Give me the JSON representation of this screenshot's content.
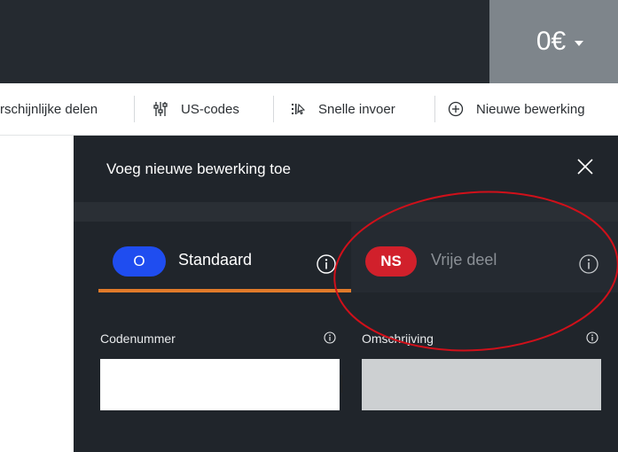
{
  "header": {
    "balance": "0€"
  },
  "toolbar": {
    "items": [
      {
        "label": "rschijnlijke delen"
      },
      {
        "label": "US-codes"
      },
      {
        "label": "Snelle invoer"
      },
      {
        "label": "Nieuwe bewerking"
      }
    ]
  },
  "panel": {
    "title": "Voeg nieuwe bewerking toe",
    "tabs": [
      {
        "badge": "O",
        "label": "Standaard"
      },
      {
        "badge": "NS",
        "label": "Vrije deel"
      }
    ],
    "fields": [
      {
        "label": "Codenummer",
        "value": ""
      },
      {
        "label": "Omschrijving",
        "value": ""
      }
    ]
  },
  "colors": {
    "header_bg": "#252a30",
    "panel_bg": "#20252b",
    "accent_orange": "#e07a2a",
    "badge_blue": "#1f4df0",
    "badge_red": "#d1202b",
    "annotation_red": "#d0101a"
  },
  "icons": [
    "caret-down-icon",
    "sliders-icon",
    "quick-entry-icon",
    "plus-circle-icon",
    "close-icon",
    "info-icon"
  ]
}
